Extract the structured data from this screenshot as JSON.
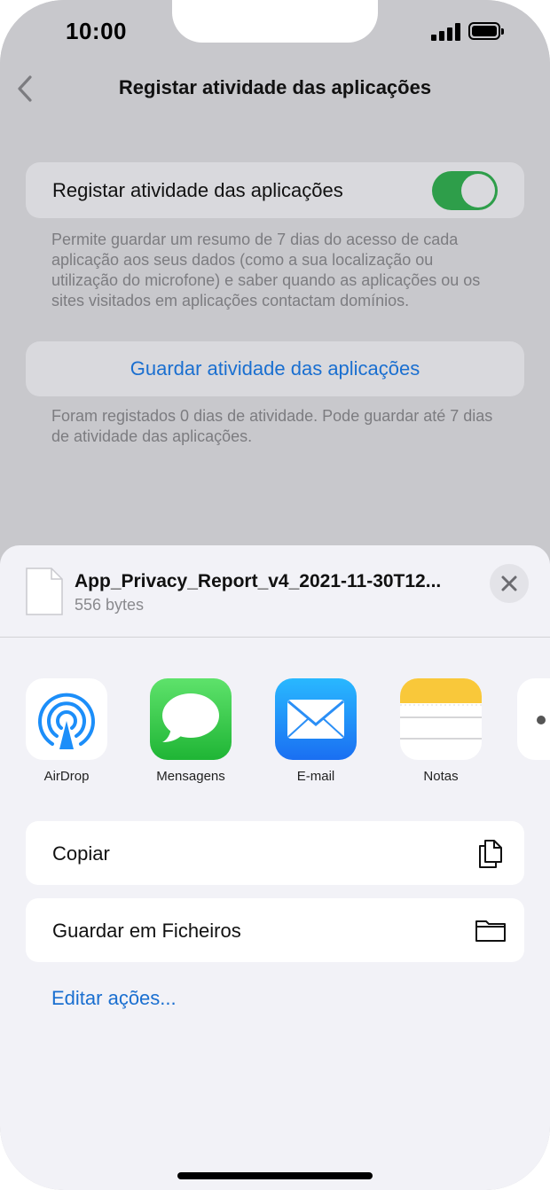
{
  "status_bar": {
    "time": "10:00"
  },
  "nav": {
    "title": "Registar atividade das aplicações"
  },
  "settings": {
    "toggle_label": "Registar atividade das aplicações",
    "toggle_on": true,
    "description": "Permite guardar um resumo de 7 dias do acesso de cada aplicação aos seus dados (como a sua localização ou utilização do microfone) e saber quando as aplicações ou os sites visitados em aplicações contactam domínios.",
    "save_button": "Guardar atividade das aplicações",
    "save_footnote": "Foram registados 0 dias de atividade. Pode guardar até 7 dias de atividade das aplicações."
  },
  "share_sheet": {
    "file_name": "App_Privacy_Report_v4_2021-11-30T12...",
    "file_size": "556 bytes",
    "apps": [
      {
        "label": "AirDrop",
        "icon": "airdrop-icon"
      },
      {
        "label": "Mensagens",
        "icon": "messages-icon"
      },
      {
        "label": "E-mail",
        "icon": "mail-icon"
      },
      {
        "label": "Notas",
        "icon": "notes-icon"
      }
    ],
    "actions": [
      {
        "label": "Copiar",
        "icon": "copy-icon"
      },
      {
        "label": "Guardar em Ficheiros",
        "icon": "folder-icon"
      }
    ],
    "edit_actions": "Editar ações..."
  },
  "colors": {
    "accent": "#1a6fd0",
    "toggle_on": "#2e9e4a",
    "sheet_bg": "#f2f2f7",
    "dim_bg": "#c8c8cc"
  }
}
